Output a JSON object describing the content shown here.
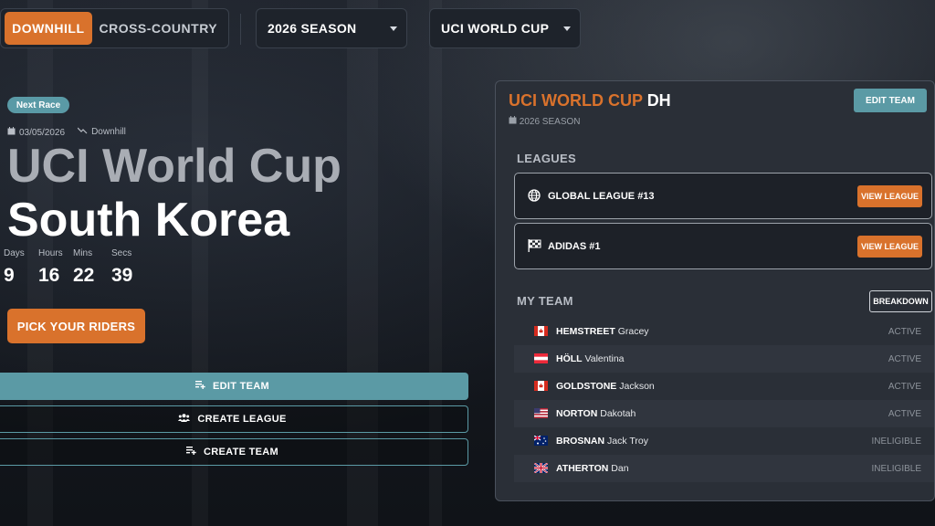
{
  "discipline": {
    "active": "DOWNHILL",
    "inactive": "CROSS-COUNTRY"
  },
  "season_select": "2026 SEASON",
  "series_select": "UCI WORLD CUP",
  "hero": {
    "badge": "Next Race",
    "date": "03/05/2026",
    "type": "Downhill",
    "title_line1": "UCI World Cup",
    "title_line2": "South Korea",
    "countdown": [
      {
        "label": "Days",
        "value": "9"
      },
      {
        "label": "Hours",
        "value": "16"
      },
      {
        "label": "Mins",
        "value": "22"
      },
      {
        "label": "Secs",
        "value": "39"
      }
    ],
    "pick_button": "PICK YOUR RIDERS"
  },
  "actions": {
    "edit_team": "EDIT TEAM",
    "create_league": "CREATE LEAGUE",
    "create_team": "CREATE TEAM"
  },
  "panel": {
    "title_orange": "UCI WORLD CUP",
    "title_white": "DH",
    "season": "2026 SEASON",
    "edit_team": "EDIT TEAM",
    "leagues_heading": "LEAGUES",
    "leagues": [
      {
        "name": "GLOBAL LEAGUE  #13",
        "icon": "globe-icon",
        "button": "VIEW LEAGUE"
      },
      {
        "name": "ADIDAS  #1",
        "icon": "checkered-flag-icon",
        "button": "VIEW LEAGUE"
      }
    ],
    "team_heading": "MY TEAM",
    "breakdown": "BREAKDOWN",
    "riders": [
      {
        "last": "HEMSTREET",
        "first": "Gracey",
        "status": "ACTIVE",
        "flag": "canada"
      },
      {
        "last": "HÖLL",
        "first": "Valentina",
        "status": "ACTIVE",
        "flag": "austria"
      },
      {
        "last": "GOLDSTONE",
        "first": "Jackson",
        "status": "ACTIVE",
        "flag": "canada"
      },
      {
        "last": "NORTON",
        "first": "Dakotah",
        "status": "ACTIVE",
        "flag": "usa"
      },
      {
        "last": "BROSNAN",
        "first": "Jack Troy",
        "status": "INELIGIBLE",
        "flag": "australia"
      },
      {
        "last": "ATHERTON",
        "first": "Dan",
        "status": "INELIGIBLE",
        "flag": "uk"
      }
    ]
  },
  "colors": {
    "accent": "#d9722c",
    "teal": "#5b9aa5",
    "panel": "#2a2f37"
  }
}
